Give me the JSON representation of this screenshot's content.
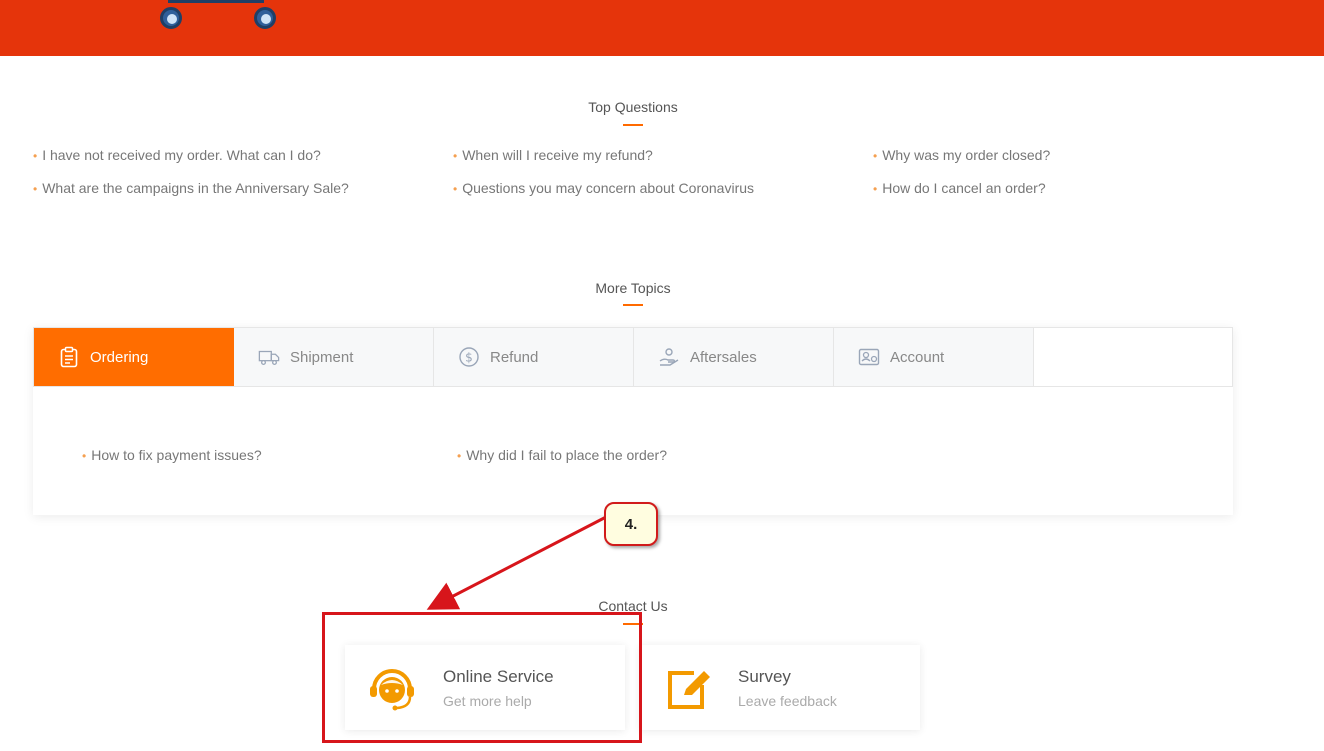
{
  "top_questions": {
    "title": "Top Questions",
    "items": [
      "I have not received my order. What can I do?",
      "When will I receive my refund?",
      "Why was my order closed?",
      "What are the campaigns in the Anniversary Sale?",
      "Questions you may concern about Coronavirus",
      "How do I cancel an order?"
    ]
  },
  "more_topics": {
    "title": "More Topics",
    "tabs": [
      {
        "label": "Ordering",
        "icon": "clipboard-icon",
        "active": true
      },
      {
        "label": "Shipment",
        "icon": "truck-icon",
        "active": false
      },
      {
        "label": "Refund",
        "icon": "dollar-coin-icon",
        "active": false
      },
      {
        "label": "Aftersales",
        "icon": "hand-support-icon",
        "active": false
      },
      {
        "label": "Account",
        "icon": "id-card-icon",
        "active": false
      }
    ],
    "questions": [
      "How to fix payment issues?",
      "Why did I fail to place the order?"
    ]
  },
  "contact_us": {
    "title": "Contact Us",
    "cards": [
      {
        "title": "Online Service",
        "subtitle": "Get more help",
        "icon": "headset-icon"
      },
      {
        "title": "Survey",
        "subtitle": "Leave feedback",
        "icon": "edit-icon"
      }
    ]
  },
  "annotation": {
    "callout_label": "4."
  },
  "colors": {
    "header": "#e5340b",
    "accent": "#ff6d00",
    "annotation": "#d7151b"
  }
}
